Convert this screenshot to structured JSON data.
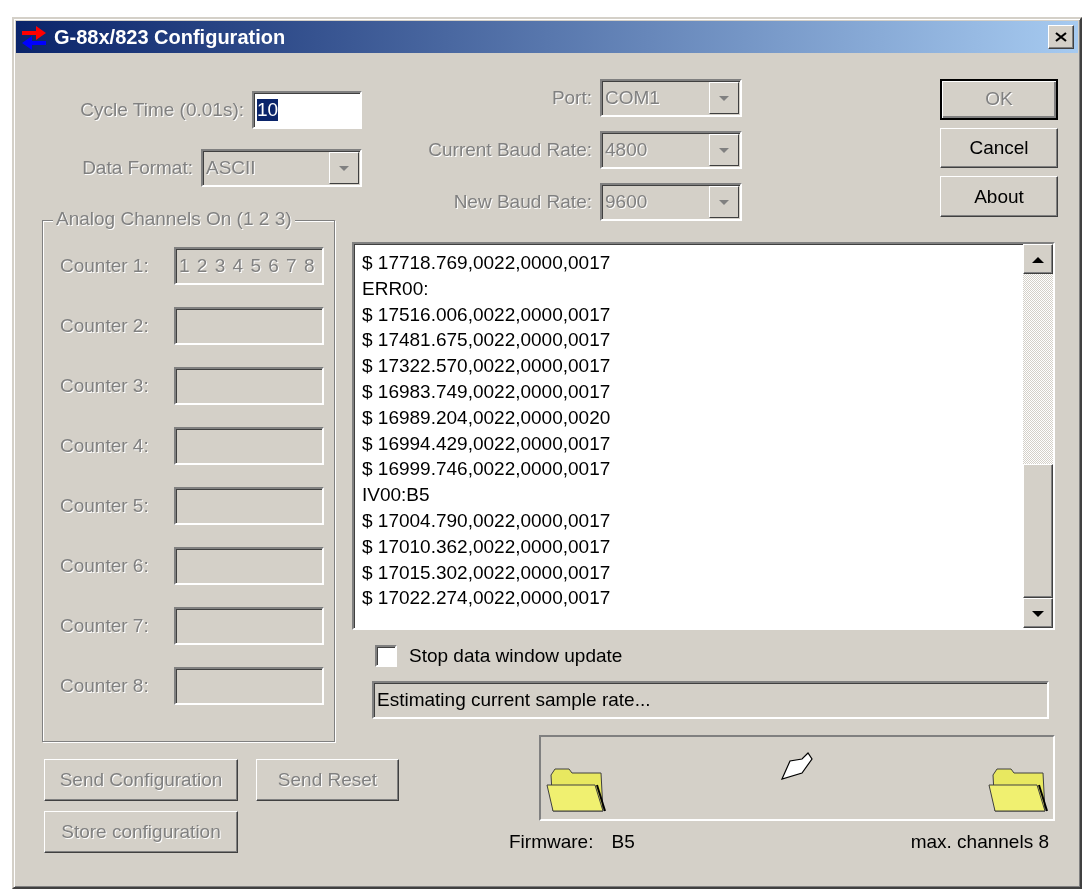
{
  "window": {
    "title": "G-88x/823 Configuration"
  },
  "settings": [
    {
      "kind": "text",
      "label": "Cycle Time (0.01s):",
      "value": "10",
      "disabled": false,
      "highlighted": true
    },
    {
      "kind": "dropdown",
      "label": "Data Format:",
      "value": "ASCII",
      "disabled": true,
      "highlighted": false
    }
  ],
  "connection": [
    {
      "label": "Port:",
      "value": "COM1",
      "disabled": true
    },
    {
      "label": "Current Baud Rate:",
      "value": "4800",
      "disabled": true
    },
    {
      "label": "New Baud Rate:",
      "value": "9600",
      "disabled": true
    }
  ],
  "dialog_buttons": [
    {
      "label": "OK",
      "disabled": true,
      "default": true
    },
    {
      "label": "Cancel",
      "disabled": false,
      "default": false
    },
    {
      "label": "About",
      "disabled": false,
      "default": false
    }
  ],
  "analog_group": {
    "title": "Analog Channels On (1 2 3)",
    "counters": [
      {
        "label": "Counter 1:",
        "value": "1 2 3 4 5 6 7 8",
        "disabled": true
      },
      {
        "label": "Counter 2:",
        "disabled": true
      },
      {
        "label": "Counter 3:",
        "disabled": true
      },
      {
        "label": "Counter 4:",
        "disabled": true
      },
      {
        "label": "Counter 5:",
        "disabled": true
      },
      {
        "label": "Counter 6:",
        "disabled": true
      },
      {
        "label": "Counter 7:",
        "disabled": true
      },
      {
        "label": "Counter 8:",
        "disabled": true
      }
    ]
  },
  "data_window": {
    "lines": [
      "$ 17718.769,0022,0000,0017",
      "ERR00:",
      "$ 17516.006,0022,0000,0017",
      "$ 17481.675,0022,0000,0017",
      "$ 17322.570,0022,0000,0017",
      "$ 16983.749,0022,0000,0017",
      "$ 16989.204,0022,0000,0020",
      "$ 16994.429,0022,0000,0017",
      "$ 16999.746,0022,0000,0017",
      "IV00:B5",
      "$ 17004.790,0022,0000,0017",
      "$ 17010.362,0022,0000,0017",
      "$ 17015.302,0022,0000,0017",
      "$ 17022.274,0022,0000,0017"
    ]
  },
  "stop_update": {
    "label": "Stop data window update",
    "checked": false
  },
  "status": "Estimating current sample rate...",
  "action_buttons": [
    {
      "label": "Send Configuration",
      "disabled": true
    },
    {
      "label": "Send Reset",
      "disabled": true
    },
    {
      "label": "Store configuration",
      "disabled": true
    }
  ],
  "firmware": {
    "label": "Firmware:",
    "value": "B5"
  },
  "max_channels": "max. channels 8"
}
